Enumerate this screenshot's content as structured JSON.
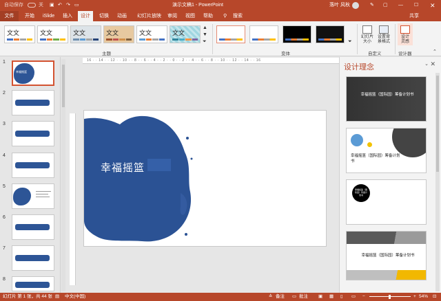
{
  "titlebar": {
    "autosave": "自动保存",
    "autosave_state": "关",
    "doc_title": "演示文稿1 - PowerPoint",
    "user": "落叶 风秋",
    "colors": {
      "accent": "#b7472a",
      "dark": "#a33e24"
    }
  },
  "tabs": [
    {
      "label": "文件"
    },
    {
      "label": "开始"
    },
    {
      "label": "iSlide"
    },
    {
      "label": "插入"
    },
    {
      "label": "设计"
    },
    {
      "label": "切换"
    },
    {
      "label": "动画"
    },
    {
      "label": "幻灯片放映"
    },
    {
      "label": "审阅"
    },
    {
      "label": "视图"
    },
    {
      "label": "帮助"
    }
  ],
  "search": {
    "label": "搜索"
  },
  "share": {
    "label": "共享"
  },
  "ribbon": {
    "themes": [
      {
        "text": "文文"
      },
      {
        "text": "文文"
      },
      {
        "text": "文文"
      },
      {
        "text": "文文"
      },
      {
        "text": "文文"
      },
      {
        "text": "文文"
      }
    ],
    "group_themes": "主题",
    "group_variants": "变体",
    "group_customize": "自定义",
    "group_designer": "设计器",
    "slide_size": "幻灯片\n大小",
    "format_bg": "设置背\n景格式",
    "design_ideas_btn": "设计\n灵感"
  },
  "slides": [
    {
      "num": "1",
      "label": "幸福摇篮"
    },
    {
      "num": "2",
      "label": ""
    },
    {
      "num": "3",
      "label": ""
    },
    {
      "num": "4",
      "label": ""
    },
    {
      "num": "5",
      "label": ""
    },
    {
      "num": "6",
      "label": ""
    },
    {
      "num": "7",
      "label": ""
    },
    {
      "num": "8",
      "label": ""
    }
  ],
  "slide": {
    "title": "幸福摇篮"
  },
  "ruler": {
    "ticks": "16 · · 14 · · 12 · · 10 · · 8 · · 6 · · 4 · · 2 · · 0 · · 2 · · 4 · · 6 · · 8 · · 10 · · 12 · · 14 · · 16"
  },
  "design_pane": {
    "title": "设计理念",
    "ideas": [
      {
        "text": "幸福摇篮（国际园）筹备计划书"
      },
      {
        "text": "幸福摇篮（国际园）筹备计划书"
      },
      {
        "text": "幸福摇篮（国际园）筹备计划书"
      },
      {
        "text": "幸福摇篮（国际园）筹备计划书"
      }
    ]
  },
  "status": {
    "slide_count": "幻灯片 第 1 张，共 44 张",
    "lang": "中文(中国)",
    "notes": "备注",
    "comments": "批注",
    "zoom": "54%"
  }
}
